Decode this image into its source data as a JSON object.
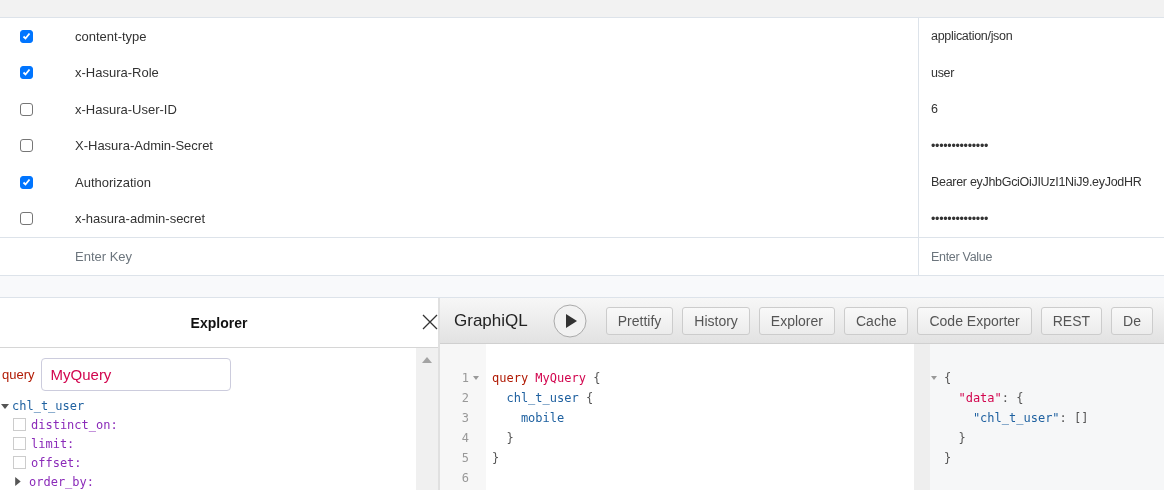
{
  "headers_table": {
    "rows": [
      {
        "enabled": true,
        "key": "content-type",
        "value": "application/json"
      },
      {
        "enabled": true,
        "key": "x-Hasura-Role",
        "value": "user"
      },
      {
        "enabled": false,
        "key": "x-Hasura-User-ID",
        "value": "6"
      },
      {
        "enabled": false,
        "key": "X-Hasura-Admin-Secret",
        "value": "••••••••••••••"
      },
      {
        "enabled": true,
        "key": "Authorization",
        "value": "Bearer eyJhbGciOiJIUzI1NiJ9.eyJodHR"
      },
      {
        "enabled": false,
        "key": "x-hasura-admin-secret",
        "value": "••••••••••••••"
      }
    ],
    "new_row": {
      "key_placeholder": "Enter Key",
      "value_placeholder": "Enter Value"
    }
  },
  "explorer": {
    "title": "Explorer",
    "operation_label": "query",
    "operation_name": "MyQuery",
    "tree": [
      {
        "name": "chl_t_user",
        "expanded": true,
        "children": [
          {
            "kind": "arg",
            "name": "distinct_on:",
            "checked": false
          },
          {
            "kind": "arg",
            "name": "limit:",
            "checked": false
          },
          {
            "kind": "arg",
            "name": "offset:",
            "checked": false
          },
          {
            "kind": "expandable",
            "name": "order_by:",
            "expanded": false
          }
        ]
      }
    ]
  },
  "graphiql": {
    "title": "GraphiQL",
    "buttons": [
      "Prettify",
      "History",
      "Explorer",
      "Cache",
      "Code Exporter",
      "REST",
      "De"
    ],
    "query_lines": [
      {
        "number": "1",
        "foldable": true,
        "tokens": [
          {
            "kind": "keyword",
            "text": "query"
          },
          {
            "kind": "name",
            "text": " MyQuery"
          },
          {
            "kind": "punct",
            "text": " {"
          }
        ]
      },
      {
        "number": "2",
        "foldable": false,
        "tokens": [
          {
            "kind": "field",
            "text": "  chl_t_user"
          },
          {
            "kind": "punct",
            "text": " {"
          }
        ]
      },
      {
        "number": "3",
        "foldable": false,
        "tokens": [
          {
            "kind": "field",
            "text": "    mobile"
          }
        ]
      },
      {
        "number": "4",
        "foldable": false,
        "tokens": [
          {
            "kind": "punct",
            "text": "  }"
          }
        ]
      },
      {
        "number": "5",
        "foldable": false,
        "tokens": [
          {
            "kind": "punct",
            "text": "}"
          }
        ]
      },
      {
        "number": "6",
        "foldable": false
      }
    ],
    "result_lines": [
      {
        "foldable": true,
        "tokens": [
          {
            "kind": "punct",
            "text": "{"
          }
        ]
      },
      {
        "foldable": false,
        "tokens": [
          {
            "kind": "key",
            "text": "  \"data\""
          },
          {
            "kind": "punct",
            "text": ": {"
          }
        ]
      },
      {
        "foldable": false,
        "tokens": [
          {
            "kind": "field",
            "text": "    \"chl_t_user\""
          },
          {
            "kind": "punct",
            "text": ": []"
          }
        ]
      },
      {
        "foldable": false,
        "tokens": [
          {
            "kind": "punct",
            "text": "  }"
          }
        ]
      },
      {
        "foldable": false,
        "tokens": [
          {
            "kind": "punct",
            "text": "}"
          }
        ]
      }
    ]
  }
}
